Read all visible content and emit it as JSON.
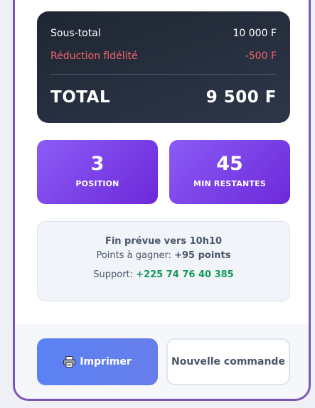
{
  "receipt": {
    "subtotal_label": "Sous-total",
    "subtotal_value": "10 000 F",
    "discount_label": "Réduction fidélité",
    "discount_value": "-500 F",
    "total_label": "TOTAL",
    "total_value": "9 500 F"
  },
  "stats": {
    "position_value": "3",
    "position_label": "POSITION",
    "minutes_value": "45",
    "minutes_label": "MIN RESTANTES"
  },
  "info": {
    "eta": "Fin prévue vers 10h10",
    "points_prefix": "Points à gagner: ",
    "points_value": "+95 points",
    "support_prefix": "Support: ",
    "support_phone": "+225 74 76 40 385"
  },
  "actions": {
    "print_label": "Imprimer",
    "new_order_label": "Nouvelle commande"
  },
  "colors": {
    "accent_purple": "#7c3aed",
    "discount_red": "#f0636e",
    "phone_green": "#15965b",
    "print_blue": "#5b82f4"
  },
  "icons": {
    "print": "printer-icon"
  }
}
